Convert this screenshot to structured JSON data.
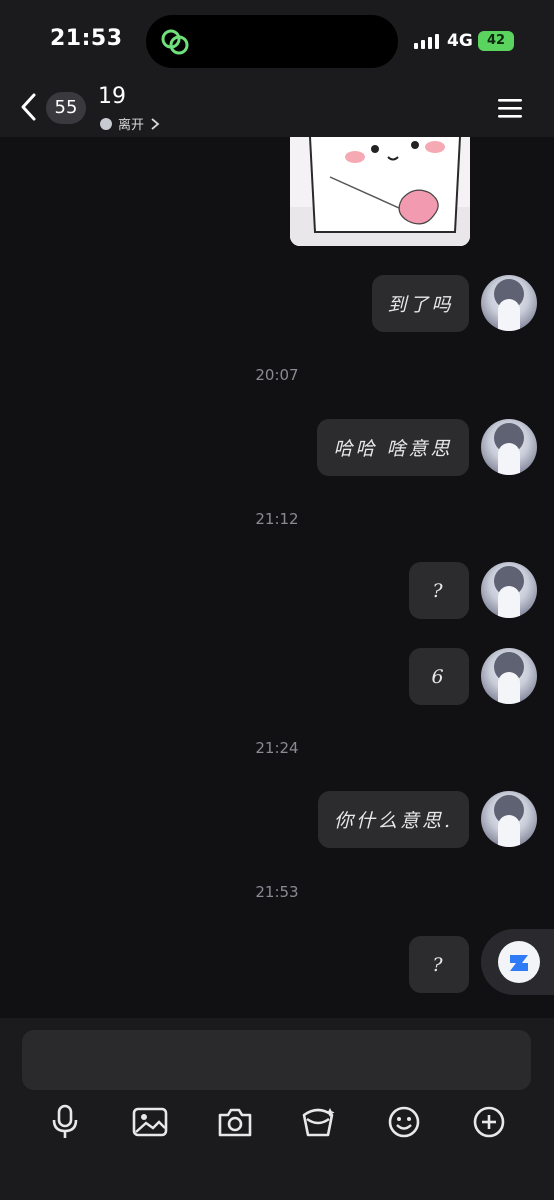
{
  "status_bar": {
    "time": "21:53",
    "network": "4G",
    "battery": "42"
  },
  "header": {
    "unread_count": "55",
    "contact_name": "19",
    "presence_status": "离开"
  },
  "messages": [
    {
      "type": "sticker"
    },
    {
      "type": "text",
      "text": "到了吗"
    },
    {
      "type": "time",
      "text": "20:07"
    },
    {
      "type": "text",
      "text": "哈哈 啥意思"
    },
    {
      "type": "time",
      "text": "21:12"
    },
    {
      "type": "text",
      "text": "?"
    },
    {
      "type": "text",
      "text": "6"
    },
    {
      "type": "time",
      "text": "21:24"
    },
    {
      "type": "text",
      "text": "你什么意思."
    },
    {
      "type": "time",
      "text": "21:53"
    },
    {
      "type": "text",
      "text": "?"
    }
  ],
  "composer": {
    "input_value": ""
  },
  "toolbar": [
    "microphone-icon",
    "image-icon",
    "camera-icon",
    "red-packet-icon",
    "emoji-icon",
    "plus-icon"
  ],
  "colors": {
    "background": "#111114",
    "bar": "#1b1b1e",
    "bubble": "#2c2c2f",
    "accent_green": "#5bd35f",
    "float_blue": "#2f7bf6"
  }
}
